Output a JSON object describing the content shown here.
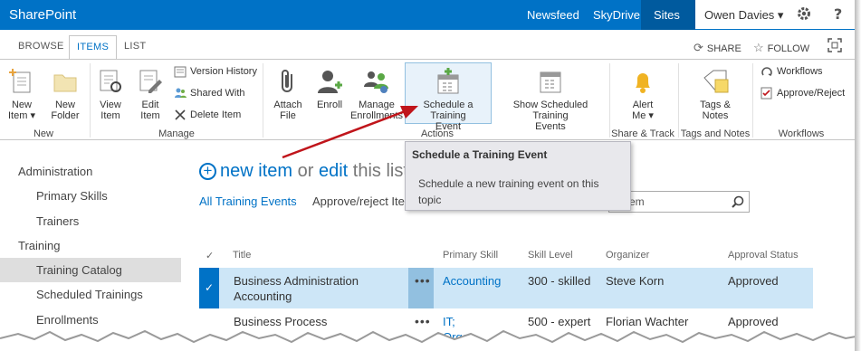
{
  "suitebar": {
    "brand": "SharePoint",
    "links": [
      "Newsfeed",
      "SkyDrive",
      "Sites"
    ],
    "user": "Owen Davies ▾"
  },
  "tabs": {
    "browse": "BROWSE",
    "items": "ITEMS",
    "list": "LIST",
    "share": "SHARE",
    "follow": "FOLLOW"
  },
  "ribbon": {
    "new": {
      "new_item_line1": "New",
      "new_item_line2": "Item ▾",
      "new_folder_line1": "New",
      "new_folder_line2": "Folder",
      "label": "New"
    },
    "manage": {
      "view_line1": "View",
      "view_line2": "Item",
      "edit_line1": "Edit",
      "edit_line2": "Item",
      "version_history": "Version History",
      "shared_with": "Shared With",
      "delete_item": "Delete Item",
      "label": "Manage"
    },
    "actions": {
      "attach_line1": "Attach",
      "attach_line2": "File",
      "enroll": "Enroll",
      "manage_enroll_line1": "Manage",
      "manage_enroll_line2": "Enrollments",
      "schedule_line1": "Schedule a Training",
      "schedule_line2": "Event",
      "show_sched_line1": "Show Scheduled Training",
      "show_sched_line2": "Events",
      "label": "Actions"
    },
    "share_track": {
      "alert_line1": "Alert",
      "alert_line2": "Me ▾",
      "label": "Share & Track"
    },
    "tags": {
      "line1": "Tags &",
      "line2": "Notes",
      "label": "Tags and Notes"
    },
    "workflows": {
      "workflows": "Workflows",
      "approve_reject": "Approve/Reject",
      "label": "Workflows"
    }
  },
  "tooltip": {
    "title": "Schedule a Training Event",
    "description": "Schedule a new training event on this topic"
  },
  "nav": {
    "administration": "Administration",
    "primary_skills": "Primary Skills",
    "trainers": "Trainers",
    "training": "Training",
    "training_catalog": "Training Catalog",
    "scheduled_trainings": "Scheduled Trainings",
    "enrollments": "Enrollments"
  },
  "main": {
    "new_item": "new item",
    "or": "or",
    "edit": "edit",
    "this_list": "this list",
    "view_all": "All Training Events",
    "view_approve": "Approve/reject Ite",
    "search_text": "em"
  },
  "table": {
    "headers": [
      "Title",
      "Primary Skill",
      "Skill Level",
      "Organizer",
      "Approval Status"
    ],
    "rows": [
      {
        "title_line1": "Business Administration",
        "title_line2": "Accounting",
        "skill": "Accounting",
        "level": "300 - skilled",
        "organizer": "Steve Korn",
        "status": "Approved"
      },
      {
        "title_line1": "Business Process",
        "skill_line1": "IT;",
        "skill_line2": "Organ",
        "level": "500 - expert",
        "organizer": "Florian Wachter",
        "status": "Approved"
      }
    ]
  },
  "colors": {
    "suitebar": "#0072c6",
    "accent": "#0072c6",
    "selected_row": "#cde6f7",
    "arrow": "#c0151b"
  }
}
